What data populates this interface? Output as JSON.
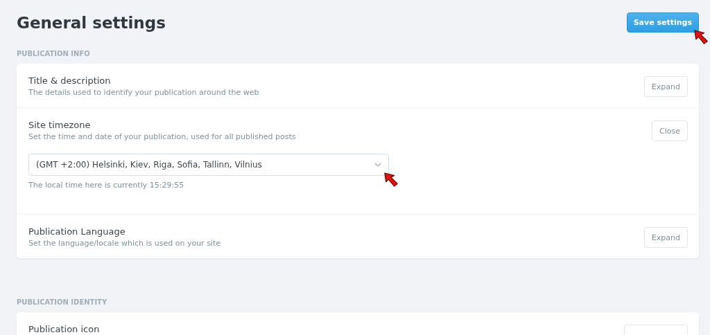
{
  "header": {
    "title": "General settings",
    "save_button": {
      "label": "Save settings",
      "pointer_arrow": true
    }
  },
  "sections": [
    {
      "label": "PUBLICATION INFO",
      "rows": [
        {
          "title": "Title & description",
          "description": "The details used to identify your publication around the web",
          "button": "Expand"
        },
        {
          "title": "Site timezone",
          "description": "Set the time and date of your publication, used for all published posts",
          "button": "Close",
          "select": {
            "value": "(GMT +2:00) Helsinki, Kiev, Riga, Sofia, Tallinn, Vilnius",
            "pointer_arrow": true
          },
          "hint": "The local time here is currently 15:29:55"
        },
        {
          "title": "Publication Language",
          "description": "Set the language/locale which is used on your site",
          "button": "Expand"
        }
      ]
    },
    {
      "label": "PUBLICATION IDENTITY",
      "rows": [
        {
          "title": "Publication icon"
        }
      ]
    }
  ]
}
